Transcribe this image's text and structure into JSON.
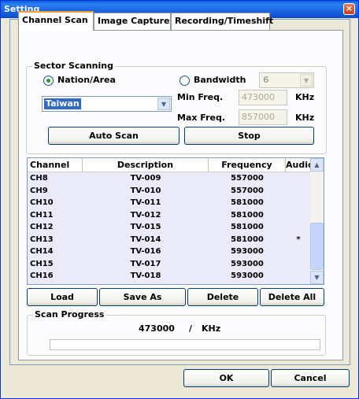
{
  "window": {
    "title": "Setting",
    "close_glyph": "×"
  },
  "tabs": [
    {
      "label": "Channel Scan",
      "active": true
    },
    {
      "label": "Image Capture",
      "active": false
    },
    {
      "label": "Recording/Timeshift",
      "active": false
    }
  ],
  "sector": {
    "title": "Sector Scanning",
    "nation_label": "Nation/Area",
    "nation_value": "Taiwan",
    "bandwidth_label": "Bandwidth",
    "bandwidth_value": "6",
    "min_freq_label": "Min Freq.",
    "min_freq_value": "473000",
    "max_freq_label": "Max Freq.",
    "max_freq_value": "857000",
    "unit": "KHz",
    "auto_scan_label": "Auto Scan",
    "stop_label": "Stop"
  },
  "channels": {
    "columns": [
      "Channel",
      "Description",
      "Frequency",
      "Audio"
    ],
    "rows": [
      [
        "CH8",
        "TV-009",
        "557000",
        ""
      ],
      [
        "CH9",
        "TV-010",
        "557000",
        ""
      ],
      [
        "CH10",
        "TV-011",
        "581000",
        ""
      ],
      [
        "CH11",
        "TV-012",
        "581000",
        ""
      ],
      [
        "CH12",
        "TV-015",
        "581000",
        ""
      ],
      [
        "CH13",
        "TV-014",
        "581000",
        "*"
      ],
      [
        "CH14",
        "TV-016",
        "593000",
        ""
      ],
      [
        "CH15",
        "TV-017",
        "593000",
        ""
      ],
      [
        "CH16",
        "TV-018",
        "593000",
        ""
      ]
    ]
  },
  "list_actions": {
    "load": "Load",
    "save_as": "Save As",
    "delete": "Delete",
    "delete_all": "Delete All"
  },
  "progress": {
    "title": "Scan Progress",
    "value": "473000",
    "separator": "/",
    "unit": "KHz",
    "fraction": 0
  },
  "footer": {
    "ok": "OK",
    "cancel": "Cancel"
  },
  "colors": {
    "title_bar": "#0a5fd8",
    "list_bg": "#eaeaf8",
    "selection": "#316ac5"
  }
}
